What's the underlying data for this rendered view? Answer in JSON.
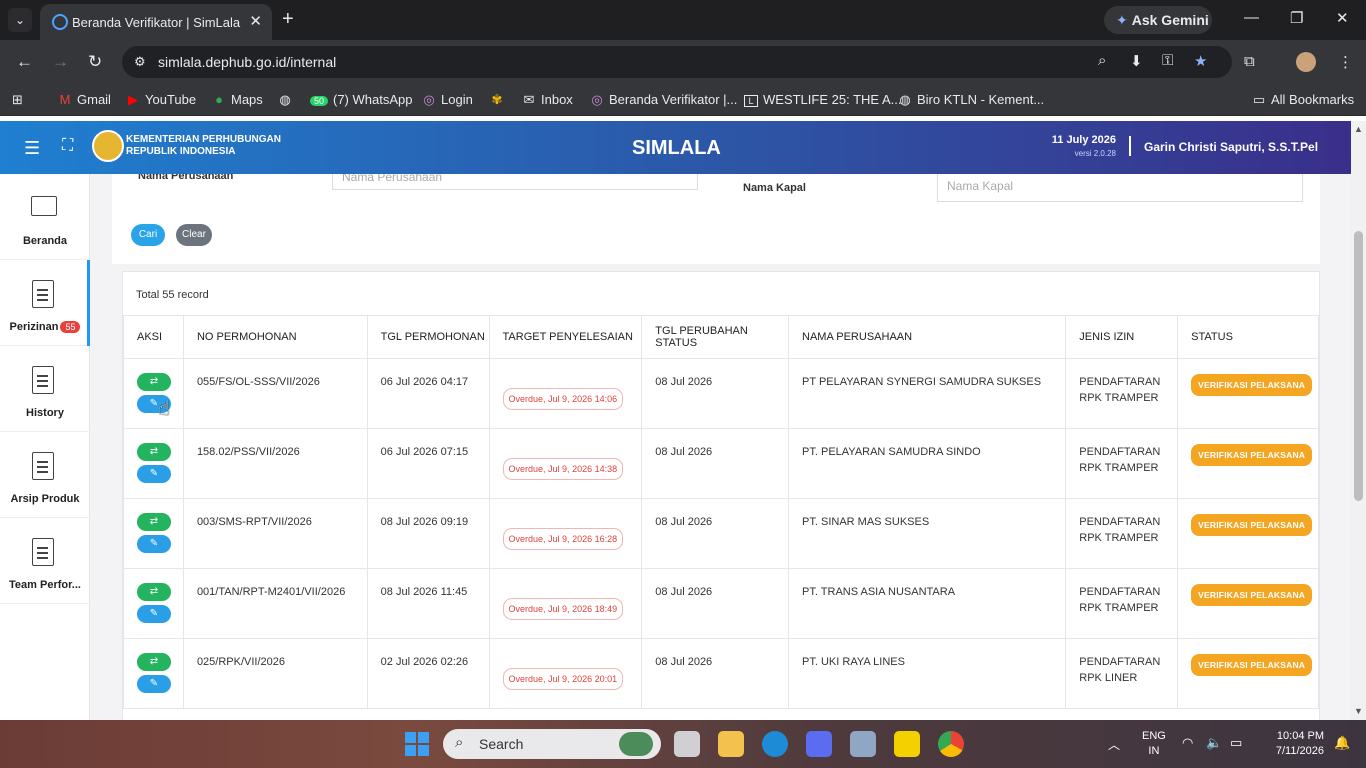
{
  "browser": {
    "tab_title": "Beranda Verifikator | SimLala",
    "url": "simlala.dephub.go.id/internal",
    "gemini_label": "Ask Gemini",
    "bookmarks": {
      "gmail": "Gmail",
      "youtube": "YouTube",
      "maps": "Maps",
      "whatsapp": "(7) WhatsApp",
      "whatsapp_count": "50",
      "login": "Login",
      "inbox": "Inbox",
      "beranda": "Beranda Verifikator |...",
      "westlife": "WESTLIFE 25: THE A...",
      "biro": "Biro KTLN - Kement...",
      "all": "All Bookmarks"
    }
  },
  "header": {
    "org_line1": "KEMENTERIAN PERHUBUNGAN",
    "org_line2": "REPUBLIK INDONESIA",
    "app_title": "SIMLALA",
    "date": "11 July 2026",
    "version": "versi 2.0.28",
    "user": "Garin Christi Saputri, S.S.T.Pel"
  },
  "sidebar": {
    "items": [
      {
        "label": "Beranda",
        "icon": "monitor-icon"
      },
      {
        "label": "Perizinan",
        "icon": "document-icon",
        "badge": "55"
      },
      {
        "label": "History",
        "icon": "document-icon"
      },
      {
        "label": "Arsip Produk",
        "icon": "document-icon"
      },
      {
        "label": "Team Perfor...",
        "icon": "document-icon"
      }
    ]
  },
  "filter": {
    "perusahaan_label": "Nama Perusahaan",
    "perusahaan_placeholder": "Nama Perusahaan",
    "kapal_label": "Nama Kapal",
    "kapal_placeholder": "Nama Kapal",
    "cari": "Cari",
    "clear": "Clear"
  },
  "table": {
    "total": "Total 55 record",
    "columns": [
      "AKSI",
      "NO PERMOHONAN",
      "TGL PERMOHONAN",
      "TARGET PENYELESAIAN",
      "TGL PERUBAHAN STATUS",
      "NAMA PERUSAHAAN",
      "JENIS IZIN",
      "STATUS"
    ],
    "rows": [
      {
        "no": "055/FS/OL-SSS/VII/2026",
        "tgl": "06 Jul 2026 04:17",
        "target": "Overdue, Jul 9, 2026 14:06",
        "ubah": "08 Jul 2026",
        "perusahaan": "PT PELAYARAN SYNERGI SAMUDRA SUKSES",
        "izin1": "PENDAFTARAN",
        "izin2": "RPK TRAMPER",
        "status": "VERIFIKASI PELAKSANA"
      },
      {
        "no": "158.02/PSS/VII/2026",
        "tgl": "06 Jul 2026 07:15",
        "target": "Overdue, Jul 9, 2026 14:38",
        "ubah": "08 Jul 2026",
        "perusahaan": "PT. PELAYARAN SAMUDRA SINDO",
        "izin1": "PENDAFTARAN",
        "izin2": "RPK TRAMPER",
        "status": "VERIFIKASI PELAKSANA"
      },
      {
        "no": "003/SMS-RPT/VII/2026",
        "tgl": "08 Jul 2026 09:19",
        "target": "Overdue, Jul 9, 2026 16:28",
        "ubah": "08 Jul 2026",
        "perusahaan": "PT. SINAR MAS SUKSES",
        "izin1": "PENDAFTARAN",
        "izin2": "RPK TRAMPER",
        "status": "VERIFIKASI PELAKSANA"
      },
      {
        "no": "001/TAN/RPT-M2401/VII/2026",
        "tgl": "08 Jul 2026 11:45",
        "target": "Overdue, Jul 9, 2026 18:49",
        "ubah": "08 Jul 2026",
        "perusahaan": "PT. TRANS ASIA NUSANTARA",
        "izin1": "PENDAFTARAN",
        "izin2": "RPK TRAMPER",
        "status": "VERIFIKASI PELAKSANA"
      },
      {
        "no": "025/RPK/VII/2026",
        "tgl": "02 Jul 2026 02:26",
        "target": "Overdue, Jul 9, 2026 20:01",
        "ubah": "08 Jul 2026",
        "perusahaan": "PT. UKI RAYA LINES",
        "izin1": "PENDAFTARAN",
        "izin2": "RPK LINER",
        "status": "VERIFIKASI PELAKSANA"
      }
    ]
  },
  "taskbar": {
    "search": "Search",
    "lang1": "ENG",
    "lang2": "IN",
    "time": "10:04 PM",
    "date": "7/11/2026"
  },
  "colors": {
    "accent": "#2196f3",
    "overdue": "#e0433d",
    "status": "#f4a622"
  }
}
